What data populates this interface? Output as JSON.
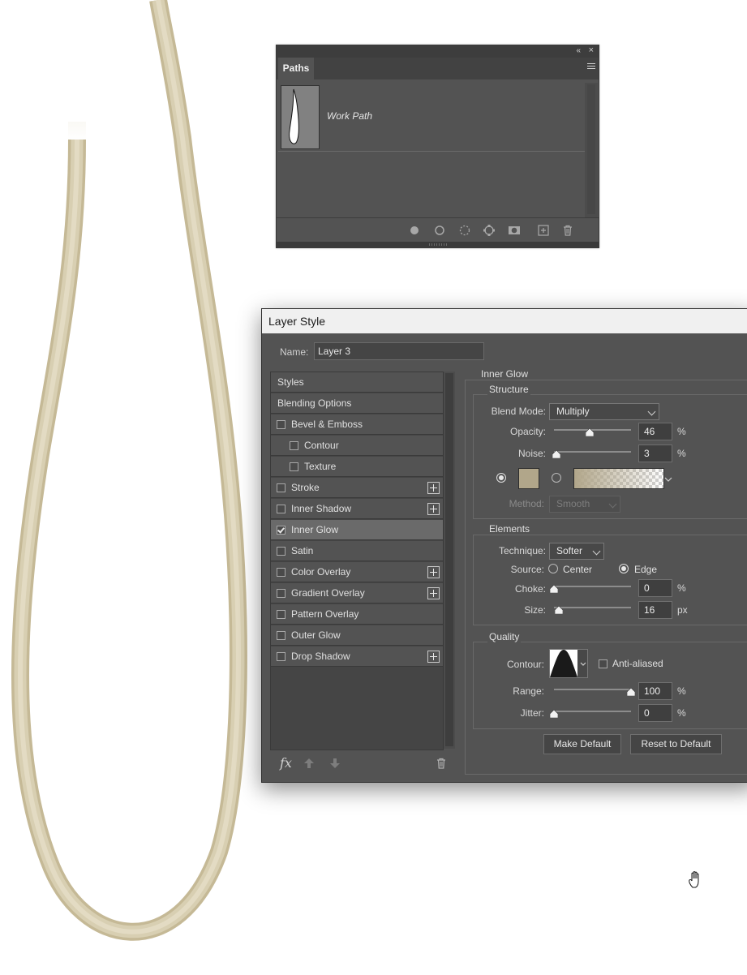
{
  "paths_panel": {
    "tab_label": "Paths",
    "collapse_glyph": "«",
    "close_glyph": "×",
    "rows": [
      {
        "name": "Work Path"
      }
    ],
    "footer_icons": [
      "fill-path-icon",
      "stroke-path-icon",
      "load-as-selection-icon",
      "make-work-path-icon",
      "add-mask-icon",
      "new-path-icon",
      "delete-path-icon"
    ]
  },
  "layer_style": {
    "title": "Layer Style",
    "name_label": "Name:",
    "name_value": "Layer 3",
    "styles": [
      {
        "label": "Styles",
        "checkbox": false,
        "checked": false,
        "indent": false,
        "plus": false,
        "selected": false
      },
      {
        "label": "Blending Options",
        "checkbox": false,
        "checked": false,
        "indent": false,
        "plus": false,
        "selected": false
      },
      {
        "label": "Bevel & Emboss",
        "checkbox": true,
        "checked": false,
        "indent": false,
        "plus": false,
        "selected": false
      },
      {
        "label": "Contour",
        "checkbox": true,
        "checked": false,
        "indent": true,
        "plus": false,
        "selected": false
      },
      {
        "label": "Texture",
        "checkbox": true,
        "checked": false,
        "indent": true,
        "plus": false,
        "selected": false
      },
      {
        "label": "Stroke",
        "checkbox": true,
        "checked": false,
        "indent": false,
        "plus": true,
        "selected": false
      },
      {
        "label": "Inner Shadow",
        "checkbox": true,
        "checked": false,
        "indent": false,
        "plus": true,
        "selected": false
      },
      {
        "label": "Inner Glow",
        "checkbox": true,
        "checked": true,
        "indent": false,
        "plus": false,
        "selected": true
      },
      {
        "label": "Satin",
        "checkbox": true,
        "checked": false,
        "indent": false,
        "plus": false,
        "selected": false
      },
      {
        "label": "Color Overlay",
        "checkbox": true,
        "checked": false,
        "indent": false,
        "plus": true,
        "selected": false
      },
      {
        "label": "Gradient Overlay",
        "checkbox": true,
        "checked": false,
        "indent": false,
        "plus": true,
        "selected": false
      },
      {
        "label": "Pattern Overlay",
        "checkbox": true,
        "checked": false,
        "indent": false,
        "plus": false,
        "selected": false
      },
      {
        "label": "Outer Glow",
        "checkbox": true,
        "checked": false,
        "indent": false,
        "plus": false,
        "selected": false
      },
      {
        "label": "Drop Shadow",
        "checkbox": true,
        "checked": false,
        "indent": false,
        "plus": true,
        "selected": false
      }
    ],
    "footer": {
      "fx_label": "fx"
    },
    "inner_glow": {
      "section_title": "Inner Glow",
      "structure": {
        "title": "Structure",
        "blend_mode_label": "Blend Mode:",
        "blend_mode_value": "Multiply",
        "opacity_label": "Opacity:",
        "opacity_value": "46",
        "opacity_unit": "%",
        "opacity_fraction": 0.46,
        "noise_label": "Noise:",
        "noise_value": "3",
        "noise_unit": "%",
        "noise_fraction": 0.03,
        "color_mode": "solid",
        "glow_color": "#b1a68a",
        "method_label": "Method:",
        "method_value": "Smooth"
      },
      "elements": {
        "title": "Elements",
        "technique_label": "Technique:",
        "technique_value": "Softer",
        "source_label": "Source:",
        "source_center": "Center",
        "source_edge": "Edge",
        "source_selected": "Edge",
        "choke_label": "Choke:",
        "choke_value": "0",
        "choke_unit": "%",
        "choke_fraction": 0.0,
        "size_label": "Size:",
        "size_value": "16",
        "size_unit": "px",
        "size_fraction": 0.064
      },
      "quality": {
        "title": "Quality",
        "contour_label": "Contour:",
        "anti_aliased_label": "Anti-aliased",
        "anti_aliased_checked": false,
        "range_label": "Range:",
        "range_value": "100",
        "range_unit": "%",
        "range_fraction": 1.0,
        "jitter_label": "Jitter:",
        "jitter_value": "0",
        "jitter_unit": "%",
        "jitter_fraction": 0.0
      },
      "make_default_label": "Make Default",
      "reset_default_label": "Reset to Default"
    }
  },
  "canvas": {
    "stroke_color": "#d6ccad"
  }
}
